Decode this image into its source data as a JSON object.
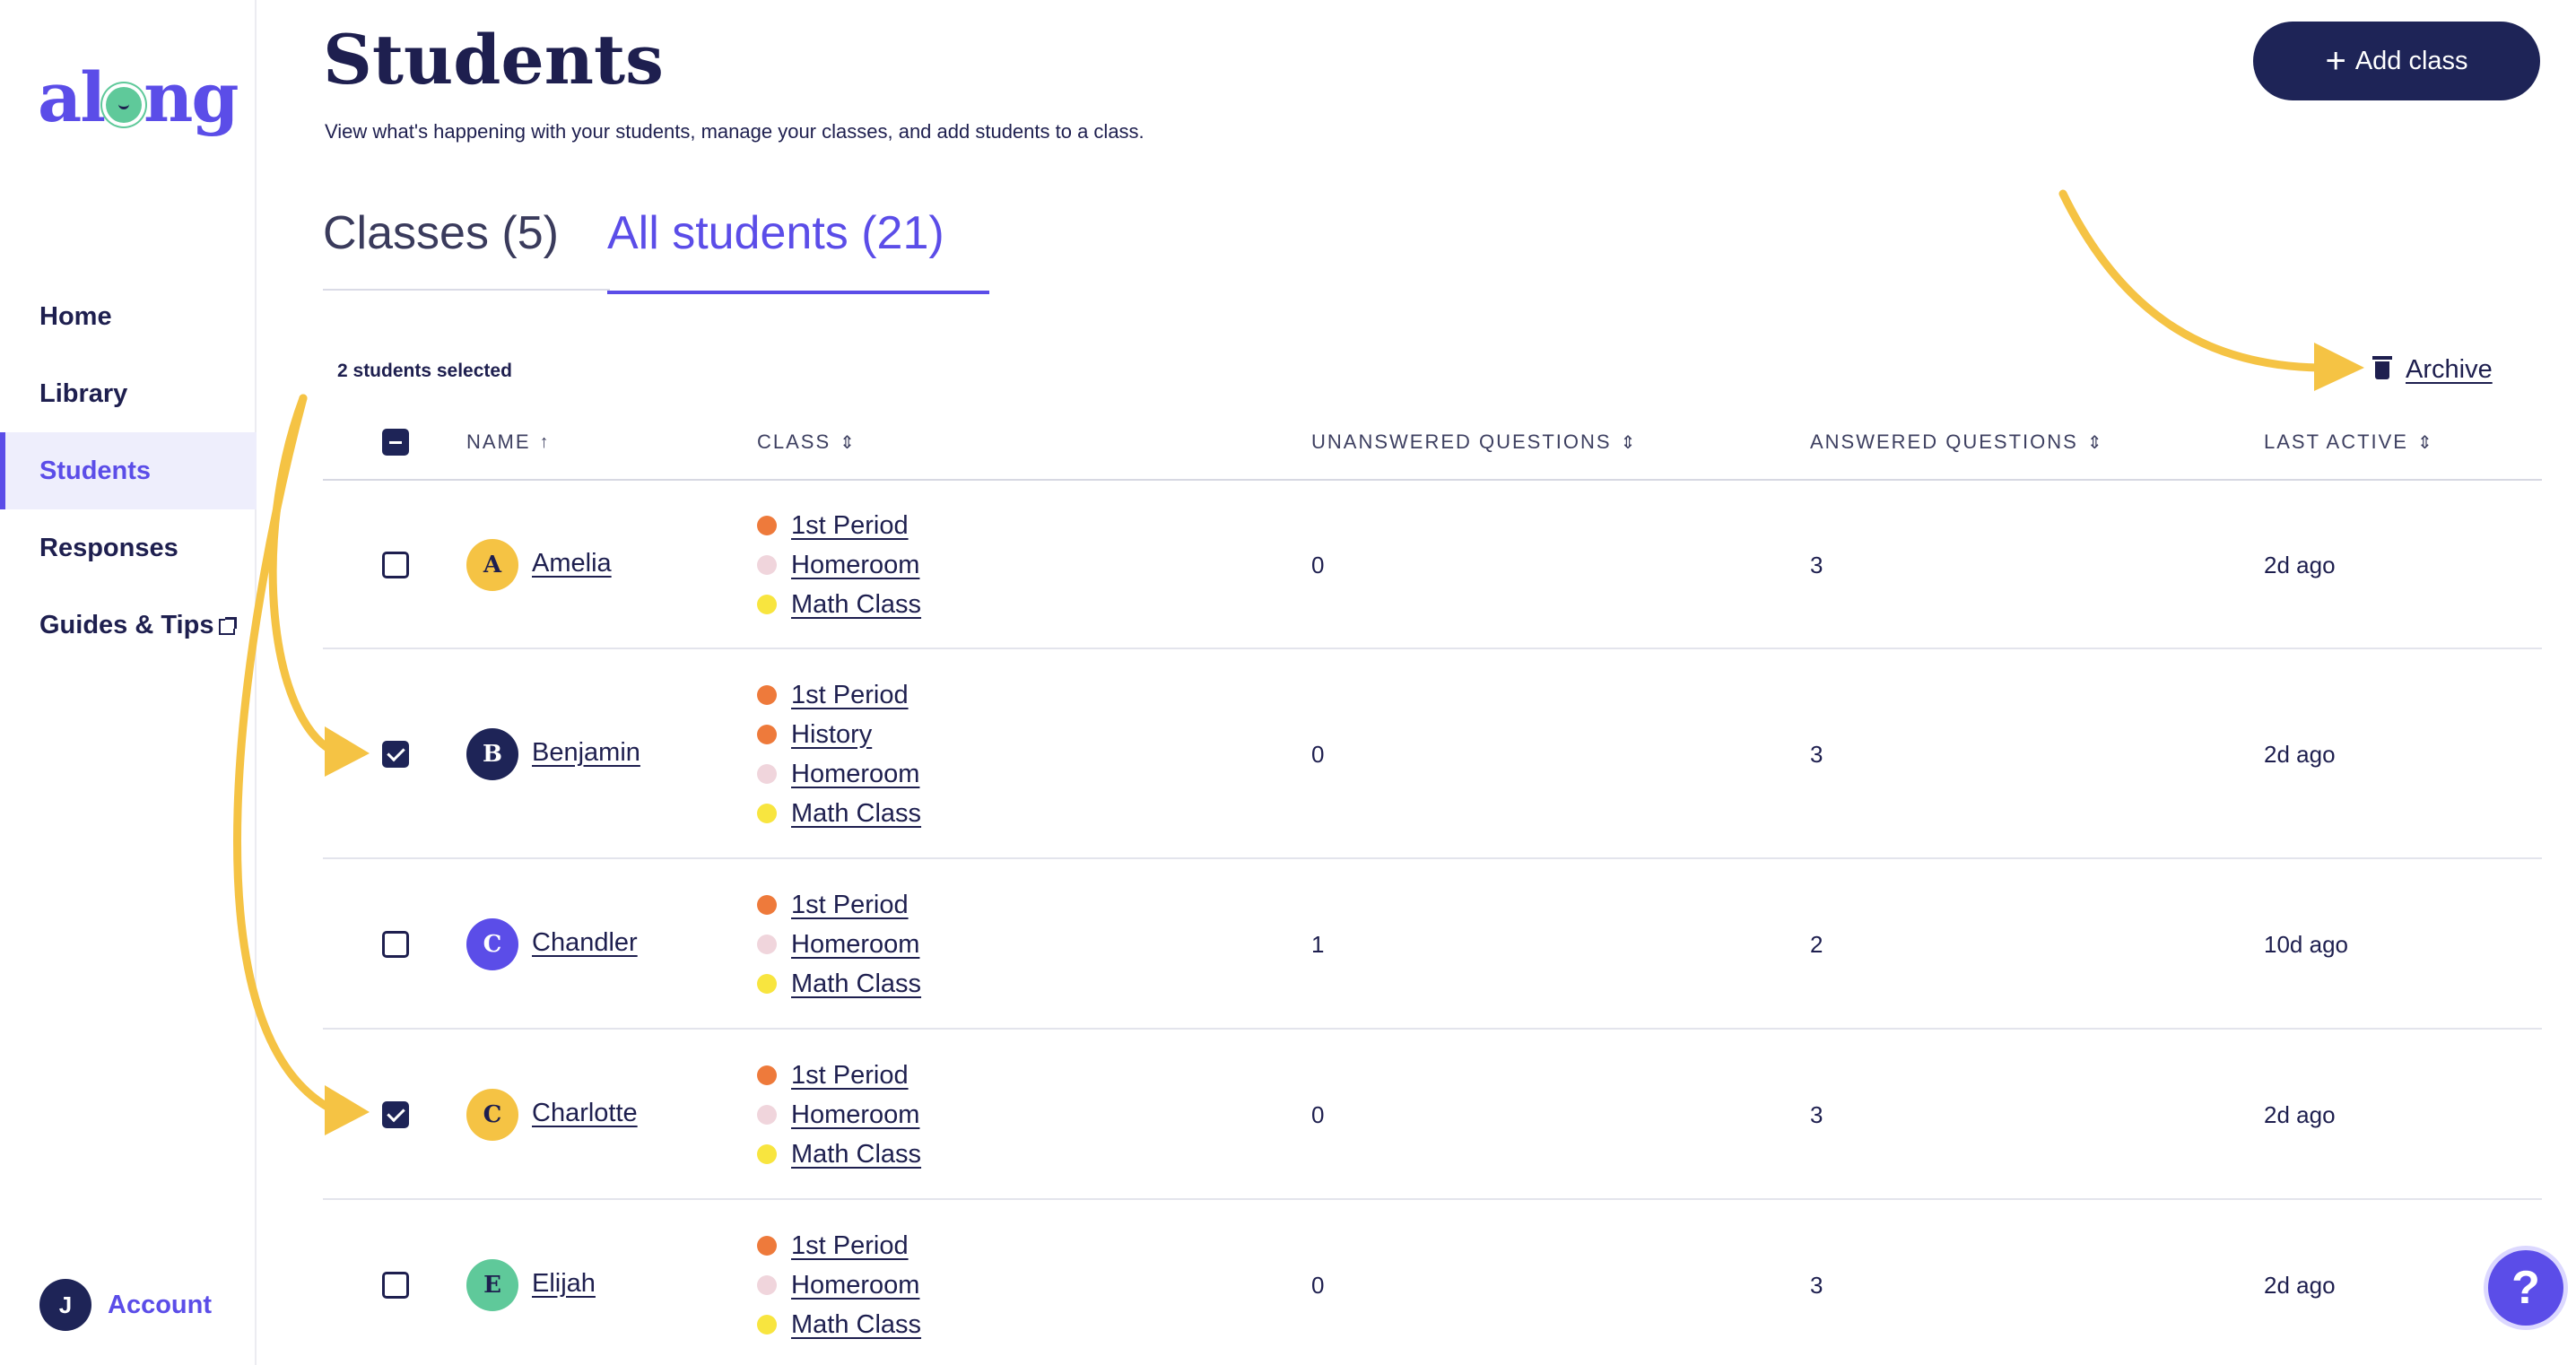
{
  "logo": {
    "text_left": "al",
    "text_right": "ng"
  },
  "nav": {
    "items": [
      {
        "label": "Home"
      },
      {
        "label": "Library"
      },
      {
        "label": "Students"
      },
      {
        "label": "Responses"
      },
      {
        "label": "Guides & Tips"
      }
    ]
  },
  "account": {
    "initial": "J",
    "label": "Account"
  },
  "header": {
    "title": "Students",
    "subtitle": "View what's happening with your students, manage your classes, and add students to a class.",
    "add_button": "Add class"
  },
  "tabs": [
    {
      "label": "Classes (5)"
    },
    {
      "label": "All students (21)"
    }
  ],
  "selection": {
    "count_label": "2 students selected",
    "archive_label": "Archive"
  },
  "table": {
    "columns": [
      "NAME",
      "CLASS",
      "UNANSWERED QUESTIONS",
      "ANSWERED QUESTIONS",
      "LAST ACTIVE"
    ],
    "rows": [
      {
        "initial": "A",
        "name": "Amelia",
        "checked": false,
        "avatar_color": "#f5c344",
        "avatar_text_color": "#1e1f4f",
        "classes": [
          {
            "label": "1st Period",
            "color": "#ee7a3b"
          },
          {
            "label": "Homeroom",
            "color": "#f0d5dc"
          },
          {
            "label": "Math Class",
            "color": "#f8e53f"
          }
        ],
        "unanswered": "0",
        "answered": "3",
        "last_active": "2d ago"
      },
      {
        "initial": "B",
        "name": "Benjamin",
        "checked": true,
        "avatar_color": "#1e2457",
        "avatar_text_color": "#ffffff",
        "classes": [
          {
            "label": "1st Period",
            "color": "#ee7a3b"
          },
          {
            "label": "History",
            "color": "#ee7a3b"
          },
          {
            "label": "Homeroom",
            "color": "#f0d5dc"
          },
          {
            "label": "Math Class",
            "color": "#f8e53f"
          }
        ],
        "unanswered": "0",
        "answered": "3",
        "last_active": "2d ago"
      },
      {
        "initial": "C",
        "name": "Chandler",
        "checked": false,
        "avatar_color": "#5b4de8",
        "avatar_text_color": "#ffffff",
        "classes": [
          {
            "label": "1st Period",
            "color": "#ee7a3b"
          },
          {
            "label": "Homeroom",
            "color": "#f0d5dc"
          },
          {
            "label": "Math Class",
            "color": "#f8e53f"
          }
        ],
        "unanswered": "1",
        "answered": "2",
        "last_active": "10d ago"
      },
      {
        "initial": "C",
        "name": "Charlotte",
        "checked": true,
        "avatar_color": "#f5c344",
        "avatar_text_color": "#1e1f4f",
        "classes": [
          {
            "label": "1st Period",
            "color": "#ee7a3b"
          },
          {
            "label": "Homeroom",
            "color": "#f0d5dc"
          },
          {
            "label": "Math Class",
            "color": "#f8e53f"
          }
        ],
        "unanswered": "0",
        "answered": "3",
        "last_active": "2d ago"
      },
      {
        "initial": "E",
        "name": "Elijah",
        "checked": false,
        "avatar_color": "#5fc99a",
        "avatar_text_color": "#1e1f4f",
        "classes": [
          {
            "label": "1st Period",
            "color": "#ee7a3b"
          },
          {
            "label": "Homeroom",
            "color": "#f0d5dc"
          },
          {
            "label": "Math Class",
            "color": "#f8e53f"
          }
        ],
        "unanswered": "0",
        "answered": "3",
        "last_active": "2d ago"
      }
    ]
  },
  "help": {
    "label": "?"
  },
  "colors": {
    "brand": "#5b4de8",
    "navy": "#1e2457",
    "annotation": "#f5c344"
  }
}
